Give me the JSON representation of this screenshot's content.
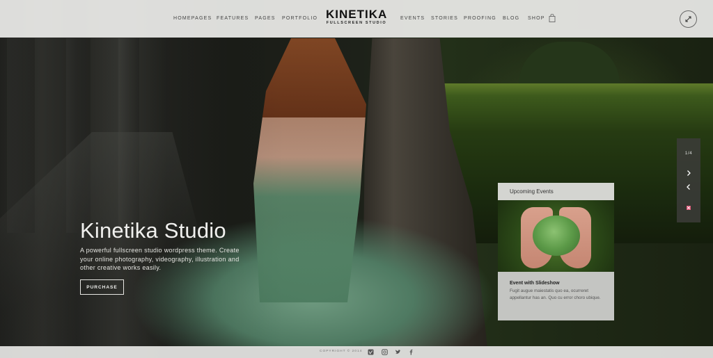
{
  "nav": {
    "items_left": [
      "HOMEPAGES",
      "FEATURES",
      "PAGES",
      "PORTFOLIO"
    ],
    "items_right": [
      "EVENTS",
      "STORIES",
      "PROOFING",
      "BLOG",
      "SHOP"
    ]
  },
  "logo": {
    "name": "KINETIKA",
    "tagline": "FULLSCREEN STUDIO"
  },
  "icons": {
    "cart": "shopping-bag-icon",
    "expand": "fullscreen-expand-icon"
  },
  "hero": {
    "title": "Kinetika Studio",
    "description": "A powerful fullscreen studio wordpress theme. Create your online photography, videography, illustration and other creative works easily.",
    "button": "PURCHASE"
  },
  "events": {
    "heading": "Upcoming Events",
    "event_title": "Event with Slideshow",
    "event_text": "Fugit augue maiestatis quo ea, ocurreret appellantur has an. Quo cu error choro ubique."
  },
  "slider": {
    "counter": "1/4"
  },
  "footer": {
    "copyright": "COPYRIGHT © 2014",
    "social": [
      "vimeo-icon",
      "instagram-icon",
      "twitter-icon",
      "facebook-icon"
    ]
  },
  "colors": {
    "header_bg": "#ecece9",
    "accent_pink": "#e05a7a"
  }
}
